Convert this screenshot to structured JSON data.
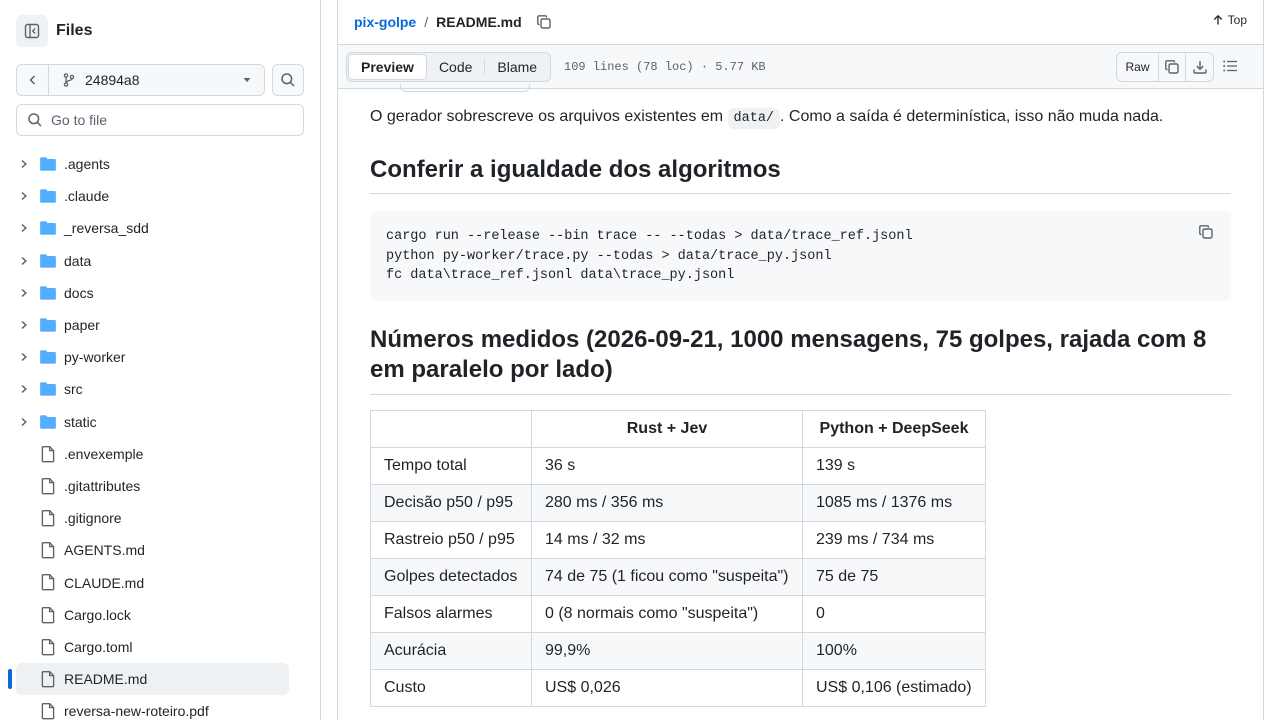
{
  "sidebar": {
    "title": "Files",
    "branch": "24894a8",
    "go_to_file_placeholder": "Go to file",
    "items": [
      {
        "name": ".agents",
        "type": "folder"
      },
      {
        "name": ".claude",
        "type": "folder"
      },
      {
        "name": "_reversa_sdd",
        "type": "folder"
      },
      {
        "name": "data",
        "type": "folder"
      },
      {
        "name": "docs",
        "type": "folder"
      },
      {
        "name": "paper",
        "type": "folder"
      },
      {
        "name": "py-worker",
        "type": "folder"
      },
      {
        "name": "src",
        "type": "folder"
      },
      {
        "name": "static",
        "type": "folder"
      },
      {
        "name": ".envexemple",
        "type": "file"
      },
      {
        "name": ".gitattributes",
        "type": "file"
      },
      {
        "name": ".gitignore",
        "type": "file"
      },
      {
        "name": "AGENTS.md",
        "type": "file"
      },
      {
        "name": "CLAUDE.md",
        "type": "file"
      },
      {
        "name": "Cargo.lock",
        "type": "file"
      },
      {
        "name": "Cargo.toml",
        "type": "file"
      },
      {
        "name": "README.md",
        "type": "file",
        "selected": true
      },
      {
        "name": "reversa-new-roteiro.pdf",
        "type": "file"
      }
    ]
  },
  "header": {
    "repo": "pix-golpe",
    "separator": "/",
    "file": "README.md",
    "top_label": "Top"
  },
  "toolbar": {
    "tabs": [
      "Preview",
      "Code",
      "Blame"
    ],
    "active_tab": "Preview",
    "file_info": "109 lines (78 loc) · 5.77 KB",
    "raw_label": "Raw"
  },
  "content": {
    "para_before": "O gerador sobrescreve os arquivos existentes em",
    "para_code": "data/",
    "para_after": ". Como a saída é determinística, isso não muda nada.",
    "heading1": "Conferir a igualdade dos algoritmos",
    "code_lines": [
      "cargo run --release --bin trace -- --todas > data/trace_ref.jsonl",
      "python py-worker/trace.py --todas > data/trace_py.jsonl",
      "fc data\\trace_ref.jsonl data\\trace_py.jsonl"
    ],
    "heading2_line1": "Números medidos (2026-09-21, 1000 mensagens, 75 golpes, rajada com 8",
    "heading2_line2": "em paralelo por lado)",
    "table": {
      "headers": [
        "",
        "Rust + Jev",
        "Python + DeepSeek"
      ],
      "rows": [
        [
          "Tempo total",
          "36 s",
          "139 s"
        ],
        [
          "Decisão p50 / p95",
          "280 ms / 356 ms",
          "1085 ms / 1376 ms"
        ],
        [
          "Rastreio p50 / p95",
          "14 ms / 32 ms",
          "239 ms / 734 ms"
        ],
        [
          "Golpes detectados",
          "74 de 75 (1 ficou como \"suspeita\")",
          "75 de 75"
        ],
        [
          "Falsos alarmes",
          "0 (8 normais como \"suspeita\")",
          "0"
        ],
        [
          "Acurácia",
          "99,9%",
          "100%"
        ],
        [
          "Custo",
          "US$ 0,026",
          "US$ 0,106 (estimado)"
        ]
      ]
    }
  }
}
